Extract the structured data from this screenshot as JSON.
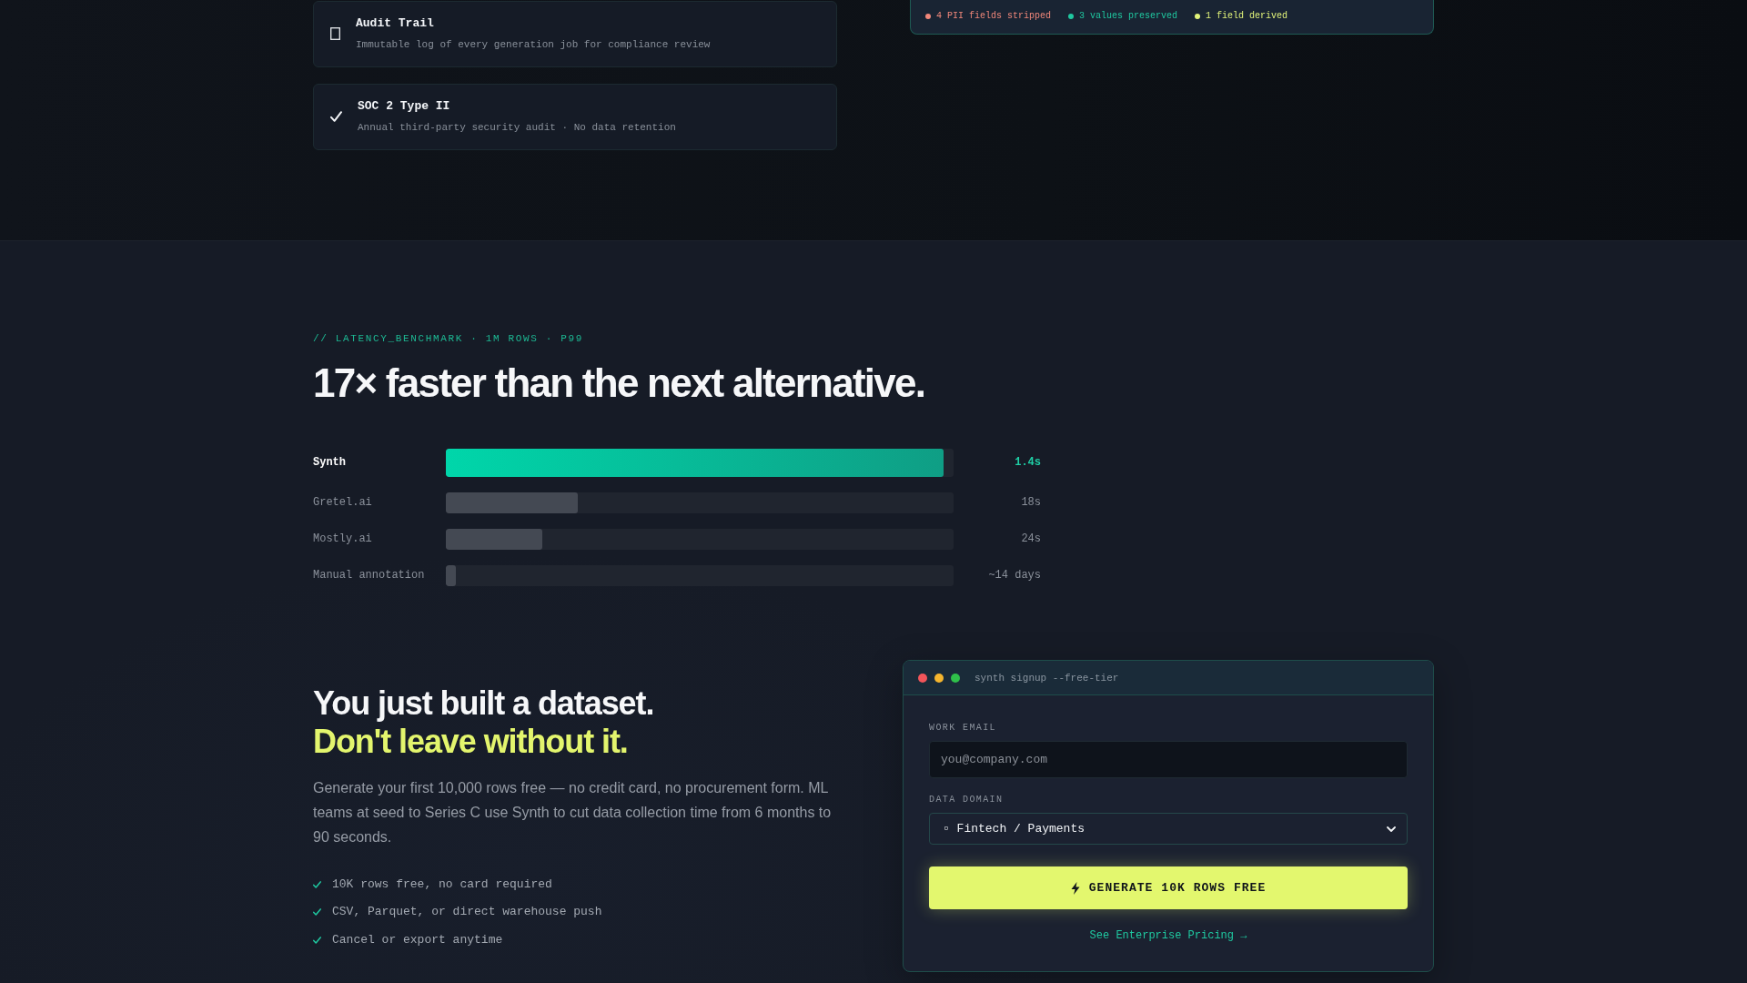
{
  "compliance_cards": [
    {
      "kind": "log",
      "title": "Audit Trail",
      "description": "Immutable log of every generation job for compliance review"
    },
    {
      "kind": "certification",
      "title": "SOC 2 Type II",
      "description": "Annual third-party security audit · No data retention"
    }
  ],
  "transform_summary": [
    {
      "label": "4 PII fields stripped",
      "color": "#f0877a"
    },
    {
      "label": "3 values preserved",
      "color": "#1fc8a0"
    },
    {
      "label": "1 field derived",
      "color": "#e2f47a"
    }
  ],
  "benchmark": {
    "eyebrow": "// LATENCY_BENCHMARK · 1M ROWS · P99",
    "title": "17× faster than the next alternative.",
    "rows": [
      {
        "name": "Synth",
        "highlighted": true,
        "level": 0.98,
        "reading": "1.4s"
      },
      {
        "name": "Gretel.ai",
        "highlighted": false,
        "level": 0.26,
        "reading": "18s"
      },
      {
        "name": "Mostly.ai",
        "highlighted": false,
        "level": 0.19,
        "reading": "24s"
      },
      {
        "name": "Manual annotation",
        "highlighted": false,
        "level": 0.02,
        "reading": "~14 days"
      }
    ]
  },
  "signup": {
    "heading": "You just built a dataset.",
    "tagline": "Don't leave without it.",
    "body": "Generate your first 10,000 rows free — no credit card, no procurement form. ML teams at seed to Series C use Synth to cut data collection time from 6 months to 90 seconds.",
    "perks": [
      "10K rows free, no card required",
      "CSV, Parquet, or direct warehouse push",
      "Cancel or export anytime"
    ]
  },
  "form": {
    "window_title": "synth signup --free-tier",
    "fields": [
      {
        "kind": "text",
        "label": "WORK EMAIL",
        "placeholder": "you@company.com"
      },
      {
        "kind": "select",
        "label": "DATA DOMAIN",
        "value": "▫ Fintech / Payments"
      }
    ],
    "submit": "GENERATE 10K ROWS FREE",
    "link": "See Enterprise Pricing →"
  }
}
